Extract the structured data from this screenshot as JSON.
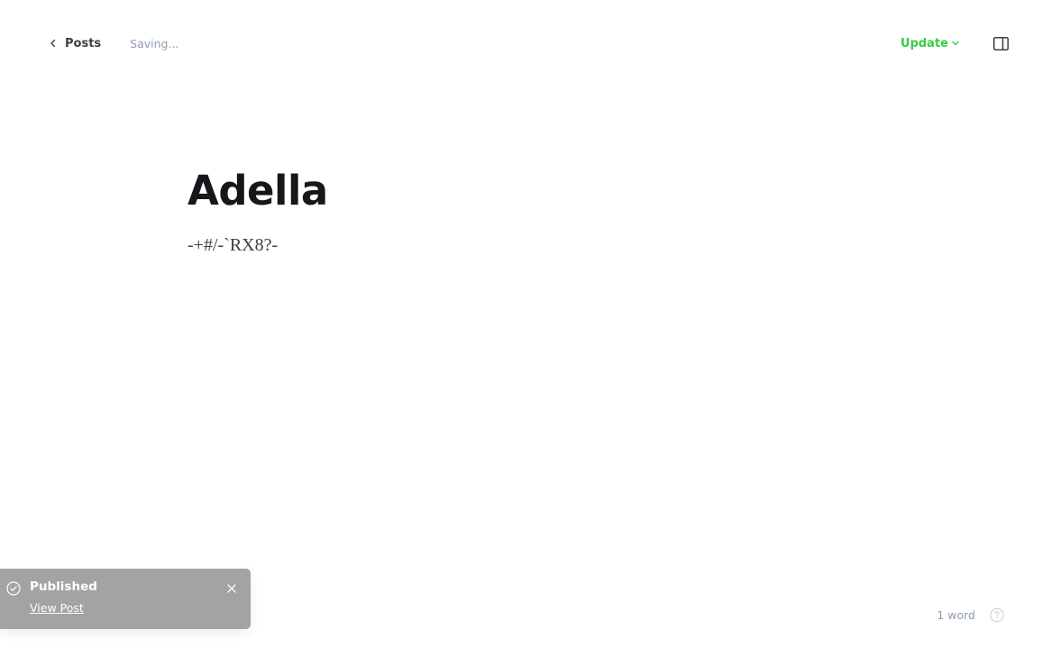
{
  "header": {
    "back_label": "Posts",
    "status": "Saving...",
    "update_label": "Update"
  },
  "post": {
    "title": "Adella",
    "body": "-+#/-`RX8?-"
  },
  "toast": {
    "title": "Published",
    "link": "View Post"
  },
  "footer": {
    "word_count": "1 word"
  },
  "colors": {
    "accent_green": "#30cf43",
    "toast_bg": "#a3a3a3",
    "muted_text": "#8e9cac"
  },
  "icons": {
    "back": "chevron-left-icon",
    "update": "chevron-down-icon",
    "sidebar": "sidebar-toggle-icon",
    "toast_status": "check-circle-icon",
    "toast_close": "close-icon",
    "help": "help-circle-icon"
  }
}
